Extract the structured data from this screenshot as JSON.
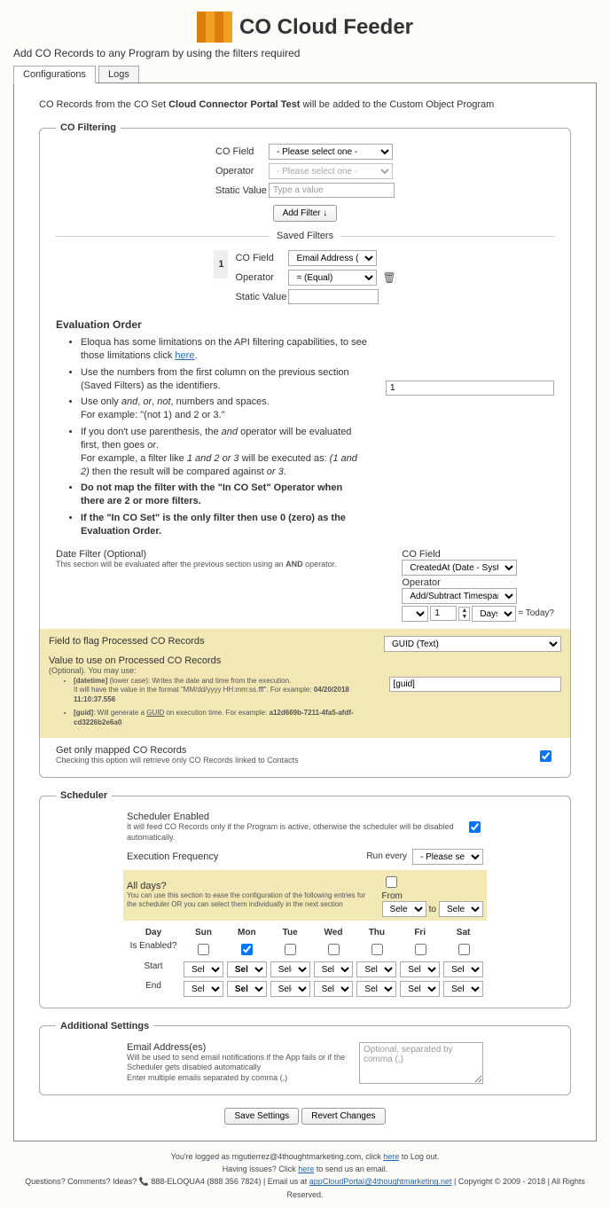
{
  "header": {
    "title": "CO Cloud Feeder"
  },
  "subtitle": "Add CO Records to any Program by using the filters required",
  "tabs": {
    "t1": "Configurations",
    "t2": "Logs"
  },
  "intro": {
    "p1": "CO Records from the CO Set ",
    "bold": "Cloud Connector Portal Test",
    "p2": " will be added to the Custom Object Program"
  },
  "legend": {
    "filt": "CO Filtering",
    "sched": "Scheduler",
    "addl": "Additional Settings"
  },
  "filter": {
    "co_field": "CO Field",
    "operator": "Operator",
    "static": "Static Value",
    "sel_placeholder": "- Please select one -",
    "val_placeholder": "Type a value",
    "add_btn": "Add Filter ↓",
    "saved_hdr": "Saved Filters",
    "saved_idx": "1",
    "saved_field": "Email Address (Text)",
    "saved_op": "= (Equal)"
  },
  "eval": {
    "title": "Evaluation Order",
    "li1a": "Eloqua has some limitations on the API filtering capabilities, to see those limitations click ",
    "li1b": "here",
    "li1c": ".",
    "li2": "Use the numbers from the first column on the previous section (Saved Filters) as the identifiers.",
    "li3a": "Use only ",
    "li3b": "and",
    "li3c": ", ",
    "li3d": "or",
    "li3e": ", ",
    "li3f": "not",
    "li3g": ", numbers and spaces.",
    "li3h": "For example: \"(not 1) and 2 or 3.\"",
    "li4a": "If you don't use parenthesis, the ",
    "li4b": "and",
    "li4c": " operator will be evaluated first, then goes ",
    "li4d": "or",
    "li4e": ".",
    "li4f": "For example, a filter like ",
    "li4g": "1 and 2 or 3",
    "li4h": " will be executed as: ",
    "li4i": "(1 and 2)",
    "li4j": " then the result will be compared against ",
    "li4k": "or 3",
    "li4l": ".",
    "li5": "Do not map the filter with the \"In CO Set\" Operator when there are 2 or more filters.",
    "li6": "If the \"In CO Set\" is the only filter then use 0 (zero) as the Evaluation Order.",
    "input": "1"
  },
  "date": {
    "title": "Date Filter (Optional)",
    "sub": "This section will be evaluated after the previous section using an ",
    "sub_b": "AND",
    "sub2": " operator.",
    "co_field": "CO Field",
    "field_val": "CreatedAt (Date - System)",
    "op": "Operator",
    "op_val": "Add/Subtract Timespan",
    "plus": "+",
    "one": "1",
    "unit": "Days",
    "today": "= Today?"
  },
  "flag": {
    "t1": "Field to flag Processed CO Records",
    "sel": "GUID (Text)",
    "t2": "Value to use on Processed CO Records",
    "opt": "(Optional). You may use:",
    "b1a": "[datetime]",
    "b1b": " (lower case): Writes the date and time from the execution.",
    "b1c": "It will have the value in the format \"MM/dd/yyyy HH:mm:ss.fff\". For example: ",
    "b1d": "04/20/2018 11:10:37.556",
    "b2a": "[guid]",
    "b2b": ": Will generate a ",
    "b2c": "GUID",
    "b2d": " on execution time. For example: ",
    "b2e": "a12d669b-7211-4fa5-afdf-cd3226b2e6a0",
    "val": "[guid]"
  },
  "mapped": {
    "t": "Get only mapped CO Records",
    "s": "Checking this option will retrieve only CO Records linked to Contacts"
  },
  "sched": {
    "en_t": "Scheduler Enabled",
    "en_s": "It will feed CO Records only if the Program is active, otherwise the scheduler will be disabled automatically.",
    "freq": "Execution Frequency",
    "run": "Run every",
    "run_sel": "- Please select One -",
    "all": "All days?",
    "all_s": "You can use this section to ease the configuration of the following entries for the scheduler OR you can select them individually in the next section",
    "from": "From",
    "to": "to",
    "sel": "Select",
    "day": "Day",
    "is_en": "Is Enabled?",
    "start": "Start",
    "end": "End",
    "d": [
      "Sun",
      "Mon",
      "Tue",
      "Wed",
      "Thu",
      "Fri",
      "Sat"
    ]
  },
  "addl": {
    "t": "Email Address(es)",
    "s1": "Will be used to send email notifications if the App fails or if the Scheduler gets disabled automatically",
    "s2": "Enter multiple emails separated by comma (,)",
    "ph": "Optional, separated by comma (,)"
  },
  "btns": {
    "save": "Save Settings",
    "revert": "Revert Changes"
  },
  "footer": {
    "f1a": "You're logged as mgutierrez@4thoughtmarketing.com, click ",
    "f1b": "here",
    "f1c": " to Log out.",
    "f2a": "Having issues? Click ",
    "f2b": "here",
    "f2c": " to send us an email.",
    "f3a": "Questions? Comments? Ideas? ",
    "f3b": " 888-ELOQUA4 (888 356 7824) | Email us at ",
    "f3c": "appCloudPortal@4thoughtmarketing.net",
    "f3d": " | Copyright © 2009 - 2018 | All Rights Reserved."
  }
}
